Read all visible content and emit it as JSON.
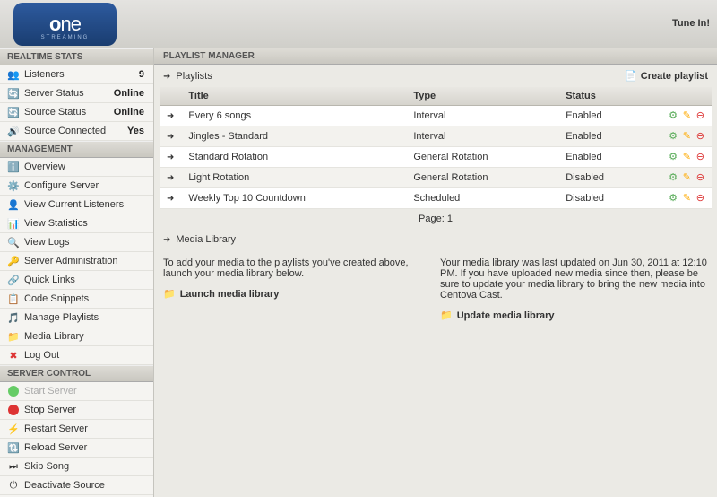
{
  "brand": {
    "name": "one",
    "sub": "STREAMING"
  },
  "header": {
    "tunein": "Tune In!"
  },
  "sidebar": {
    "realtime": {
      "title": "REALTIME STATS",
      "items": [
        {
          "label": "Listeners",
          "value": "9"
        },
        {
          "label": "Server Status",
          "value": "Online"
        },
        {
          "label": "Source Status",
          "value": "Online"
        },
        {
          "label": "Source Connected",
          "value": "Yes"
        }
      ]
    },
    "management": {
      "title": "MANAGEMENT",
      "items": [
        "Overview",
        "Configure Server",
        "View Current Listeners",
        "View Statistics",
        "View Logs",
        "Server Administration",
        "Quick Links",
        "Code Snippets",
        "Manage Playlists",
        "Media Library",
        "Log Out"
      ]
    },
    "server_control": {
      "title": "SERVER CONTROL",
      "items": [
        "Start Server",
        "Stop Server",
        "Restart Server",
        "Reload Server",
        "Skip Song",
        "Deactivate Source"
      ]
    }
  },
  "main": {
    "title": "PLAYLIST MANAGER",
    "playlists_label": "Playlists",
    "create_label": "Create playlist",
    "columns": {
      "title": "Title",
      "type": "Type",
      "status": "Status"
    },
    "rows": [
      {
        "title": "Every 6 songs",
        "type": "Interval",
        "status": "Enabled"
      },
      {
        "title": "Jingles - Standard",
        "type": "Interval",
        "status": "Enabled"
      },
      {
        "title": "Standard Rotation",
        "type": "General Rotation",
        "status": "Enabled"
      },
      {
        "title": "Light Rotation",
        "type": "General Rotation",
        "status": "Disabled"
      },
      {
        "title": "Weekly Top 10 Countdown",
        "type": "Scheduled",
        "status": "Disabled"
      }
    ],
    "pager": "Page: 1",
    "media": {
      "title": "Media Library",
      "left_text": "To add your media to the playlists you've created above, launch your media library below.",
      "left_link": "Launch media library",
      "right_text": "Your media library was last updated on Jun 30, 2011 at 12:10 PM. If you have uploaded new media since then, please be sure to update your media library to bring the new media into Centova Cast.",
      "right_link": "Update media library"
    }
  }
}
